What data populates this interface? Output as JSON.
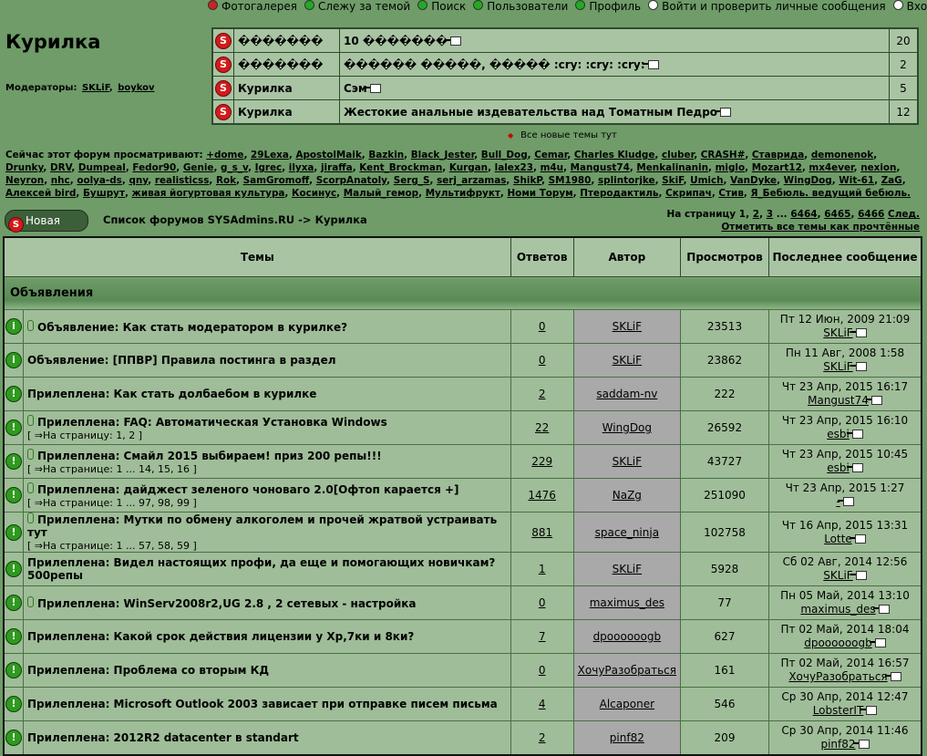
{
  "nav": [
    {
      "label": "Фотогалерея",
      "icon": "photo-icon",
      "color": "#c22"
    },
    {
      "label": "Слежу за темой",
      "icon": "watch-icon",
      "color": "#2a2"
    },
    {
      "label": "Поиск",
      "icon": "search-icon",
      "color": "#2a2"
    },
    {
      "label": "Пользователи",
      "icon": "users-icon",
      "color": "#2a2"
    },
    {
      "label": "Профиль",
      "icon": "profile-icon",
      "color": "#2a2"
    },
    {
      "label": "Войти и проверить личные сообщения",
      "icon": "messages-icon",
      "color": "#fff"
    },
    {
      "label": "Вход",
      "icon": "login-icon",
      "color": "#fff"
    }
  ],
  "forum": {
    "title": "Курилка",
    "moderators_label": "Модераторы:",
    "moderators": [
      "SKLiF",
      "boykov"
    ]
  },
  "latest_posts": [
    {
      "forum": "�������",
      "topic": "10 �������",
      "count": "20"
    },
    {
      "forum": "�������",
      "topic": "������ �����, ����� :cry: :cry: :cry:",
      "count": "2"
    },
    {
      "forum": "Курилка",
      "topic": "Сэм",
      "count": "5"
    },
    {
      "forum": "Курилка",
      "topic": "Жестокие анальные издевательства над Томатным Педро",
      "count": "12"
    }
  ],
  "all_new_label": "Все новые темы тут",
  "viewers_label": "Сейчас этот форум просматривают:",
  "viewers": [
    "+dome",
    "29Lexa",
    "ApostolMaik",
    "Bazkin",
    "Black_Jester",
    "Bull_Dog",
    "Cemar",
    "Charles Kludge",
    "cluber",
    "CRASH#",
    "Ставрида",
    "demonenok",
    "Drunky",
    "DRV",
    "Dumpeal",
    "Fedor90",
    "Genie",
    "g_s_v",
    "Igrec",
    "ilyxa",
    "jiraffa",
    "Kent_Brockman",
    "Kurgan",
    "lalex23",
    "m4u",
    "Mangust74",
    "Menkalinanin",
    "miglo",
    "Mozart12",
    "mx4ever",
    "nexion",
    "Neyron",
    "nhc",
    "oolya-ds",
    "qny",
    "realisticss",
    "Rok",
    "SamGromoff",
    "ScorpAnatoly",
    "Serg_S",
    "serj_arzamas",
    "ShikP",
    "SM1980",
    "splintorjke",
    "SkiF",
    "Umich",
    "VanDyke",
    "WingDog",
    "Wit-61",
    "ZaG",
    "Алексей bird",
    "Бушрут",
    "живая йогуртовая культура",
    "Косинус",
    "Малый_гемор",
    "Мультифрукт",
    "Номи Торум",
    "Птеродактиль",
    "Скрипач",
    "Стив",
    "Я_Бебюль. ведущий бебюль."
  ],
  "new_topic_label": "Новая тема",
  "breadcrumb": {
    "root": "Список форумов SYSAdmins.RU",
    "sep": " -> ",
    "current": "Курилка"
  },
  "pager": {
    "label": "На страницу",
    "current": "1",
    "pages": [
      "2",
      "3"
    ],
    "ellipsis": "...",
    "last_pages": [
      "6464",
      "6465",
      "6466"
    ],
    "next": "След.",
    "mark_read": "Отметить все темы как прочтённые"
  },
  "columns": [
    "Темы",
    "Ответов",
    "Автор",
    "Просмотров",
    "Последнее сообщение"
  ],
  "section": "Объявления",
  "topics": [
    {
      "icon": "info",
      "attach": true,
      "title": "Объявление: Как стать модератором в курилке?",
      "pages": null,
      "replies": "0",
      "author": "SKLiF",
      "views": "23513",
      "last_date": "Пт 12 Июн, 2009 21:09",
      "last_user": "SKLiF"
    },
    {
      "icon": "info",
      "attach": false,
      "title": "Объявление: [ППВР] Правила постинга в раздел",
      "pages": null,
      "replies": "0",
      "author": "SKLiF",
      "views": "23862",
      "last_date": "Пн 11 Авг, 2008 1:58",
      "last_user": "SKLiF"
    },
    {
      "icon": "sticky",
      "attach": false,
      "title": "Прилеплена: Как стать долбаебом в курилке",
      "pages": null,
      "replies": "2",
      "author": "saddam-nv",
      "views": "222",
      "last_date": "Чт 23 Апр, 2015 16:17",
      "last_user": "Mangust74"
    },
    {
      "icon": "sticky",
      "attach": true,
      "title": "Прилеплена: FAQ: Автоматическая Установка Windows",
      "pages": "[ ⇒На страницу: 1, 2 ]",
      "replies": "22",
      "author": "WingDog",
      "views": "26592",
      "last_date": "Чт 23 Апр, 2015 16:10",
      "last_user": "esbi"
    },
    {
      "icon": "sticky",
      "attach": true,
      "title": "Прилеплена: Смайл 2015 выбираем! приз 200 репы!!!",
      "pages": "[ ⇒На странице: 1 ... 14, 15, 16 ]",
      "replies": "229",
      "author": "SKLiF",
      "views": "43727",
      "last_date": "Чт 23 Апр, 2015 10:45",
      "last_user": "esbi"
    },
    {
      "icon": "sticky",
      "attach": true,
      "title": "Прилеплена: дайджест зеленого чоноваго 2.0[Офтоп карается +]",
      "pages": "[ ⇒На странице: 1 ... 97, 98, 99 ]",
      "replies": "1476",
      "author": "NaZg",
      "views": "251090",
      "last_date": "Чт 23 Апр, 2015 1:27",
      "last_user": "-"
    },
    {
      "icon": "sticky",
      "attach": true,
      "title": "Прилеплена: Мутки по обмену алкоголем и прочей жратвой устраивать тут",
      "pages": "[ ⇒На странице: 1 ... 57, 58, 59 ]",
      "replies": "881",
      "author": "space_ninja",
      "views": "102758",
      "last_date": "Чт 16 Апр, 2015 13:31",
      "last_user": "Lotte"
    },
    {
      "icon": "sticky",
      "attach": false,
      "title": "Прилеплена: Видел настоящих профи, да еще и помогающих новичкам? 500репы",
      "pages": null,
      "replies": "1",
      "author": "SKLiF",
      "views": "5928",
      "last_date": "Сб 02 Авг, 2014 12:56",
      "last_user": "SKLiF"
    },
    {
      "icon": "sticky",
      "attach": true,
      "title": "Прилеплена: WinServ2008r2,UG 2.8 , 2 сетевых - настройка",
      "pages": null,
      "replies": "0",
      "author": "maximus_des",
      "views": "77",
      "last_date": "Пн 05 Май, 2014 13:10",
      "last_user": "maximus_des"
    },
    {
      "icon": "sticky",
      "attach": false,
      "title": "Прилеплена: Какой срок действия лицензии у Хр,7ки и 8ки?",
      "pages": null,
      "replies": "7",
      "author": "dpoooooogb",
      "views": "627",
      "last_date": "Пт 02 Май, 2014 18:04",
      "last_user": "dpoooooogb"
    },
    {
      "icon": "sticky",
      "attach": false,
      "title": "Прилеплена: Проблема со вторым КД",
      "pages": null,
      "replies": "0",
      "author": "ХочуРазобраться",
      "views": "161",
      "last_date": "Пт 02 Май, 2014 16:57",
      "last_user": "ХочуРазобраться"
    },
    {
      "icon": "sticky",
      "attach": false,
      "title": "Прилеплена: Microsoft Outlook 2003 зависает при отправке писем письма",
      "pages": null,
      "replies": "4",
      "author": "Alcaponer",
      "views": "546",
      "last_date": "Ср 30 Апр, 2014 12:47",
      "last_user": "LobsterIT"
    },
    {
      "icon": "sticky",
      "attach": false,
      "title": "Прилеплена: 2012R2 datacenter в standart",
      "pages": null,
      "replies": "2",
      "author": "pinf82",
      "views": "209",
      "last_date": "Ср 30 Апр, 2014 11:46",
      "last_user": "pinf82"
    }
  ]
}
